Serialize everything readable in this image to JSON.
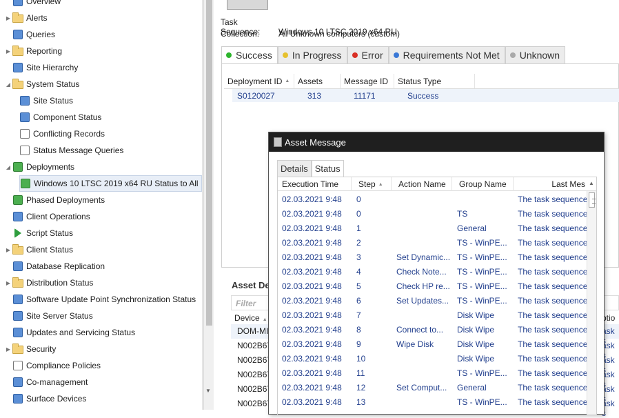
{
  "tree": {
    "items": [
      {
        "label": "Overview",
        "icon": "overview-icon",
        "level": 0,
        "expander": ""
      },
      {
        "label": "Alerts",
        "icon": "folder-icon",
        "level": 0,
        "expander": "▶"
      },
      {
        "label": "Queries",
        "icon": "queries-icon",
        "level": 0,
        "expander": ""
      },
      {
        "label": "Reporting",
        "icon": "folder-icon",
        "level": 0,
        "expander": "▶"
      },
      {
        "label": "Site Hierarchy",
        "icon": "site-hierarchy-icon",
        "level": 0,
        "expander": ""
      },
      {
        "label": "System Status",
        "icon": "folder-icon",
        "level": 0,
        "expander": "◢"
      },
      {
        "label": "Site Status",
        "icon": "site-status-icon",
        "level": 1,
        "expander": ""
      },
      {
        "label": "Component Status",
        "icon": "component-status-icon",
        "level": 1,
        "expander": ""
      },
      {
        "label": "Conflicting Records",
        "icon": "conflicting-records-icon",
        "level": 1,
        "expander": ""
      },
      {
        "label": "Status Message Queries",
        "icon": "status-message-queries-icon",
        "level": 1,
        "expander": ""
      },
      {
        "label": "Deployments",
        "icon": "deployments-icon",
        "level": 0,
        "expander": "◢"
      },
      {
        "label": "Windows 10 LTSC 2019 x64 RU Status to All",
        "icon": "deployment-status-icon",
        "level": 1,
        "expander": "",
        "selected": true
      },
      {
        "label": "Phased Deployments",
        "icon": "phased-deployments-icon",
        "level": 0,
        "expander": ""
      },
      {
        "label": "Client Operations",
        "icon": "client-operations-icon",
        "level": 0,
        "expander": ""
      },
      {
        "label": "Script Status",
        "icon": "script-status-icon",
        "level": 0,
        "expander": ""
      },
      {
        "label": "Client Status",
        "icon": "folder-icon",
        "level": 0,
        "expander": "▶"
      },
      {
        "label": "Database Replication",
        "icon": "database-replication-icon",
        "level": 0,
        "expander": ""
      },
      {
        "label": "Distribution Status",
        "icon": "folder-icon",
        "level": 0,
        "expander": "▶"
      },
      {
        "label": "Software Update Point Synchronization Status",
        "icon": "sup-sync-icon",
        "level": 0,
        "expander": ""
      },
      {
        "label": "Site Server Status",
        "icon": "site-server-status-icon",
        "level": 0,
        "expander": ""
      },
      {
        "label": "Updates and Servicing Status",
        "icon": "updates-servicing-icon",
        "level": 0,
        "expander": ""
      },
      {
        "label": "Security",
        "icon": "folder-icon",
        "level": 0,
        "expander": "▶"
      },
      {
        "label": "Compliance Policies",
        "icon": "compliance-policies-icon",
        "level": 0,
        "expander": ""
      },
      {
        "label": "Co-management",
        "icon": "co-management-icon",
        "level": 0,
        "expander": ""
      },
      {
        "label": "Surface Devices",
        "icon": "surface-devices-icon",
        "level": 0,
        "expander": ""
      }
    ]
  },
  "summary": {
    "task_sequence_label": "Task Sequence:",
    "task_sequence_value": "Windows 10 LTSC 2019 x64 RU",
    "collection_label": "Collection:",
    "collection_value": "All Unknown computers (custom)"
  },
  "status_tabs": [
    {
      "label": "Success",
      "color": "#2db52d",
      "active": true
    },
    {
      "label": "In Progress",
      "color": "#e6c12e",
      "active": false
    },
    {
      "label": "Error",
      "color": "#d93025",
      "active": false
    },
    {
      "label": "Requirements Not Met",
      "color": "#3a78d6",
      "active": false
    },
    {
      "label": "Unknown",
      "color": "#a9a9a9",
      "active": false
    }
  ],
  "deployments_grid": {
    "headers": [
      "Deployment ID",
      "Assets",
      "Message ID",
      "Status Type"
    ],
    "row": [
      "S0120027",
      "313",
      "11171",
      "Success"
    ]
  },
  "asset_details": {
    "title": "Asset De",
    "filter_placeholder": "Filter",
    "device_header": "Device",
    "options_header": "ptio",
    "rows": [
      {
        "device": "DOM-MI",
        "tail": "ask s"
      },
      {
        "device": "N002B67",
        "tail": "ask s"
      },
      {
        "device": "N002B67",
        "tail": "ask s"
      },
      {
        "device": "N002B67",
        "tail": "ask s"
      },
      {
        "device": "N002B67",
        "tail": "ask s"
      },
      {
        "device": "N002B67",
        "tail": "ask s"
      }
    ]
  },
  "dialog": {
    "title": "Asset Message",
    "tabs": [
      {
        "label": "Details",
        "active": false
      },
      {
        "label": "Status",
        "active": true
      }
    ],
    "headers": {
      "execution_time": "Execution Time",
      "step": "Step",
      "action_name": "Action Name",
      "group_name": "Group Name",
      "last_message": "Last Mes"
    },
    "rows": [
      {
        "time": "02.03.2021 9:48",
        "step": "0",
        "action": "",
        "group": "",
        "msg": "The task sequence"
      },
      {
        "time": "02.03.2021 9:48",
        "step": "0",
        "action": "",
        "group": "TS",
        "msg": "The task sequence"
      },
      {
        "time": "02.03.2021 9:48",
        "step": "1",
        "action": "",
        "group": "General",
        "msg": "The task sequence"
      },
      {
        "time": "02.03.2021 9:48",
        "step": "2",
        "action": "",
        "group": "TS - WinPE...",
        "msg": "The task sequence"
      },
      {
        "time": "02.03.2021 9:48",
        "step": "3",
        "action": "Set Dynamic...",
        "group": "TS - WinPE...",
        "msg": "The task sequence"
      },
      {
        "time": "02.03.2021 9:48",
        "step": "4",
        "action": "Check Note...",
        "group": "TS - WinPE...",
        "msg": "The task sequence"
      },
      {
        "time": "02.03.2021 9:48",
        "step": "5",
        "action": "Check HP re...",
        "group": "TS - WinPE...",
        "msg": "The task sequence"
      },
      {
        "time": "02.03.2021 9:48",
        "step": "6",
        "action": "Set Updates...",
        "group": "TS - WinPE...",
        "msg": "The task sequence"
      },
      {
        "time": "02.03.2021 9:48",
        "step": "7",
        "action": "",
        "group": "Disk Wipe",
        "msg": "The task sequence"
      },
      {
        "time": "02.03.2021 9:48",
        "step": "8",
        "action": "Connect to...",
        "group": "Disk Wipe",
        "msg": "The task sequence"
      },
      {
        "time": "02.03.2021 9:48",
        "step": "9",
        "action": "Wipe Disk",
        "group": "Disk Wipe",
        "msg": "The task sequence"
      },
      {
        "time": "02.03.2021 9:48",
        "step": "10",
        "action": "",
        "group": "Disk Wipe",
        "msg": "The task sequence"
      },
      {
        "time": "02.03.2021 9:48",
        "step": "11",
        "action": "",
        "group": "TS - WinPE...",
        "msg": "The task sequence"
      },
      {
        "time": "02.03.2021 9:48",
        "step": "12",
        "action": "Set Comput...",
        "group": "General",
        "msg": "The task sequence"
      },
      {
        "time": "02.03.2021 9:48",
        "step": "13",
        "action": "",
        "group": "TS - WinPE...",
        "msg": "The task sequence"
      }
    ]
  }
}
